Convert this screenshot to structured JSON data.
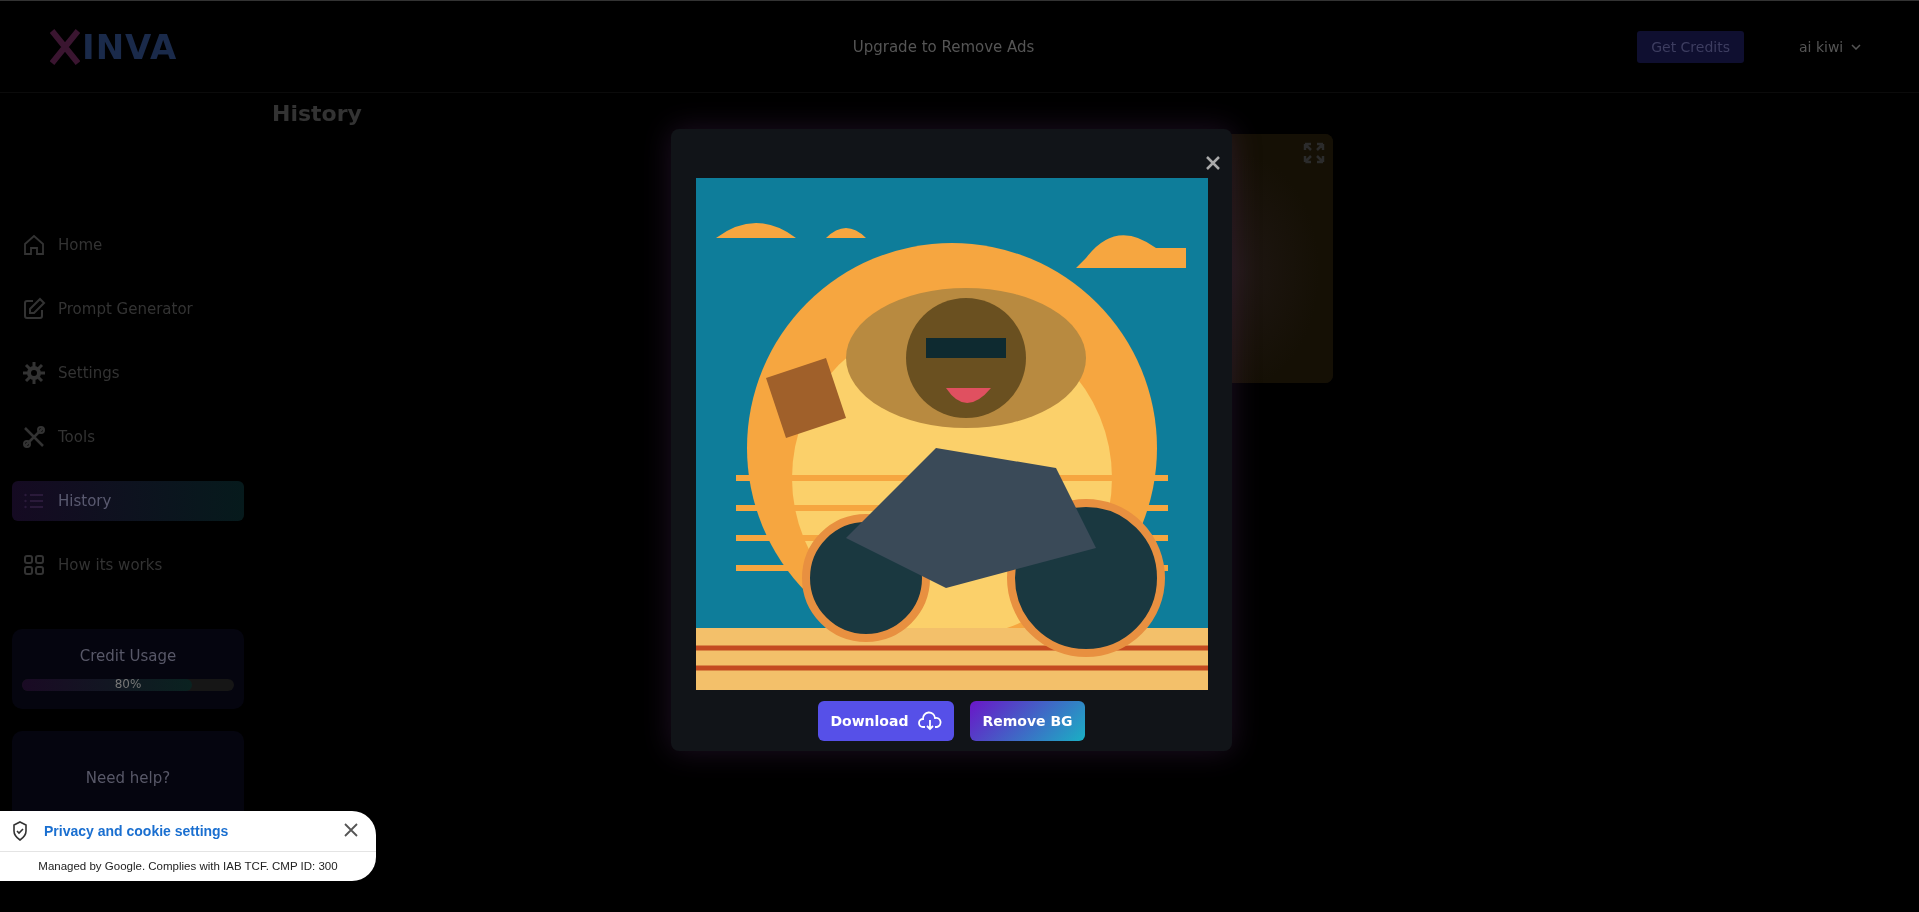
{
  "header": {
    "logo": "INVA",
    "promo": "Upgrade to Remove Ads",
    "credits_button": "Get Credits",
    "user": "ai kiwi"
  },
  "page_title": "History",
  "sidebar": {
    "items": [
      {
        "label": "Home",
        "kind": "home",
        "selected": false
      },
      {
        "label": "Prompt Generator",
        "kind": "edit",
        "selected": false
      },
      {
        "label": "Settings",
        "kind": "gear",
        "selected": false
      },
      {
        "label": "Tools",
        "kind": "tools",
        "selected": false
      },
      {
        "label": "History",
        "kind": "list",
        "selected": true
      },
      {
        "label": "How its works",
        "kind": "grid",
        "selected": false
      }
    ],
    "credit_usage": {
      "title": "Credit Usage",
      "level": 0.8,
      "reading": "80%"
    },
    "help": {
      "title": "Need help?"
    }
  },
  "modal": {
    "buttons": [
      {
        "label": "Download",
        "kind": "download"
      },
      {
        "label": "Remove BG",
        "kind": "remove_bg"
      }
    ]
  },
  "cookie_banner": {
    "title": "Privacy and cookie settings",
    "note": "Managed by Google. Complies with IAB TCF. CMP ID: 300"
  }
}
